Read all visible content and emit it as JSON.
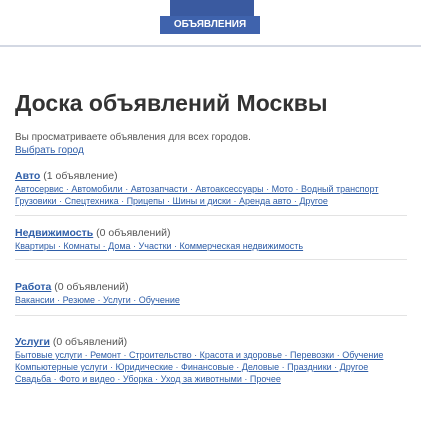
{
  "header": {
    "logo_text": "ОБЪЯВЛЕНИЯ"
  },
  "page_title": "Доска объявлений Москвы",
  "subtitle": {
    "line1": "Вы просматриваете объявления для всех городов.",
    "link": "Выбрать город"
  },
  "sections": [
    {
      "title": "Авто",
      "count": "(1 объявление)",
      "lines": [
        "Автосервис · Автомобили · Автозапчасти · Автоаксессуары · Мото · Водный транспорт",
        "Грузовики · Спецтехника · Прицепы · Шины и диски · Аренда авто · Другое"
      ]
    },
    {
      "title": "Недвижимость",
      "count": "(0 объявлений)",
      "lines": [
        "Квартиры · Комнаты · Дома · Участки · Коммерческая недвижимость"
      ]
    },
    {
      "title": "Работа",
      "count": "(0 объявлений)",
      "lines": [
        "Вакансии · Резюме · Услуги · Обучение"
      ]
    },
    {
      "title": "Услуги",
      "count": "(0 объявлений)",
      "lines": [
        "Бытовые услуги · Ремонт · Строительство · Красота и здоровье · Перевозки · Обучение",
        "Компьютерные услуги · Юридические · Финансовые · Деловые · Праздники · Другое",
        "Свадьба · Фото и видео · Уборка · Уход за животными · Прочее"
      ]
    }
  ]
}
